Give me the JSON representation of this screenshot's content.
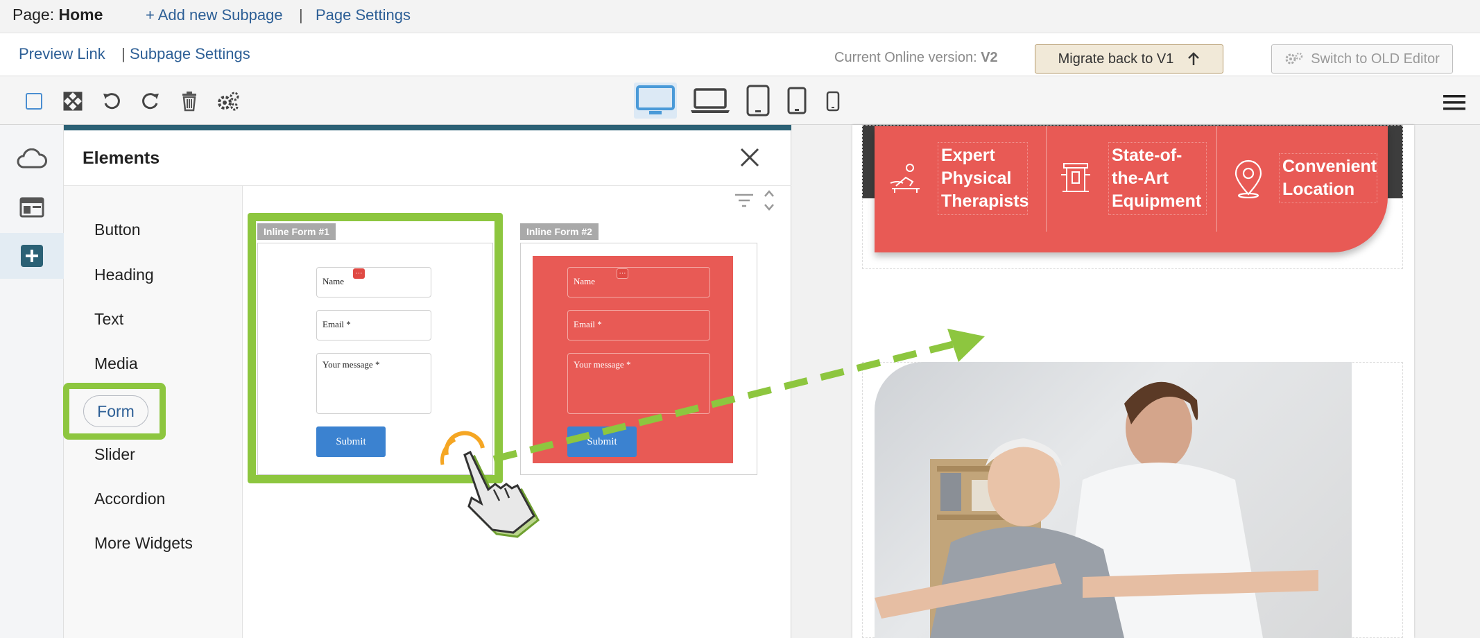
{
  "header": {
    "page_label": "Page:",
    "page_name": "Home",
    "add_subpage": "+ Add new Subpage",
    "separator": "|",
    "page_settings": "Page Settings"
  },
  "subbar": {
    "preview_link": "Preview Link",
    "separator": "|",
    "subpage_settings": "Subpage Settings",
    "online_version_label": "Current Online version:",
    "online_version_value": "V2",
    "migrate_button": "Migrate back to V1",
    "switch_old_editor": "Switch to OLD Editor"
  },
  "toolbar": {
    "icons": [
      "select-icon",
      "fullscreen-icon",
      "undo-icon",
      "redo-icon",
      "delete-icon",
      "settings-icon"
    ],
    "devices": [
      "desktop",
      "laptop",
      "tablet-landscape",
      "tablet",
      "mobile"
    ],
    "active_device": "desktop"
  },
  "left_rail": {
    "items": [
      "cloud-icon",
      "layout-icon",
      "add-icon"
    ],
    "active": "add-icon"
  },
  "elements_panel": {
    "title": "Elements",
    "categories": [
      "Button",
      "Heading",
      "Text",
      "Media",
      "Form",
      "Slider",
      "Accordion",
      "More Widgets"
    ],
    "selected_category": "Form",
    "forms": [
      {
        "tag": "Inline Form #1",
        "name_placeholder": "Name",
        "email_placeholder": "Email *",
        "message_placeholder": "Your message *",
        "submit": "Submit",
        "background": "#ffffff"
      },
      {
        "tag": "Inline Form #2",
        "name_placeholder": "Name",
        "email_placeholder": "Email *",
        "message_placeholder": "Your message *",
        "submit": "Submit",
        "background": "#e85a55"
      }
    ]
  },
  "preview": {
    "features": [
      {
        "icon": "therapist-icon",
        "text": "Expert Physical Therapists"
      },
      {
        "icon": "equipment-icon",
        "text": "State-of-the-Art Equipment"
      },
      {
        "icon": "location-pin-icon",
        "text": "Convenient Location"
      }
    ],
    "image_alt": "Therapist helping elderly man exercise"
  },
  "colors": {
    "accent_red": "#e85a55",
    "highlight_green": "#8dc63f",
    "link_blue": "#2d5f96",
    "submit_blue": "#3b82d0",
    "panel_top": "#2b6175"
  }
}
